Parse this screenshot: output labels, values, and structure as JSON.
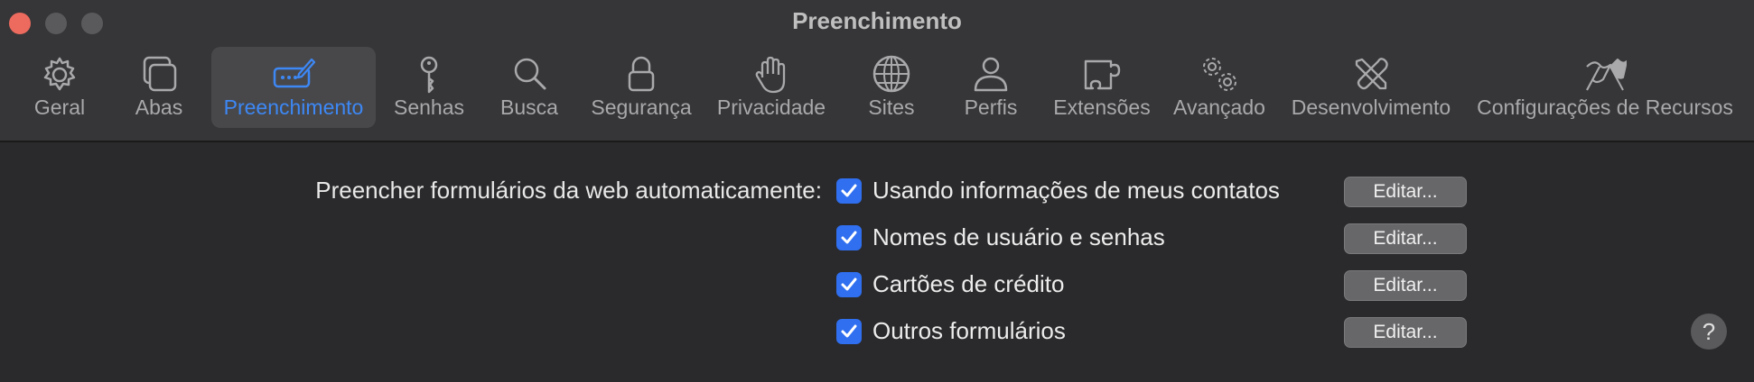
{
  "window": {
    "title": "Preenchimento"
  },
  "toolbar": {
    "tabs": [
      {
        "label": "Geral",
        "icon": "gear-icon"
      },
      {
        "label": "Abas",
        "icon": "tabs-icon"
      },
      {
        "label": "Preenchimento",
        "icon": "autofill-pen-icon",
        "active": true
      },
      {
        "label": "Senhas",
        "icon": "key-icon"
      },
      {
        "label": "Busca",
        "icon": "magnifier-icon"
      },
      {
        "label": "Segurança",
        "icon": "lock-icon"
      },
      {
        "label": "Privacidade",
        "icon": "hand-icon"
      },
      {
        "label": "Sites",
        "icon": "globe-icon"
      },
      {
        "label": "Perfis",
        "icon": "person-icon"
      },
      {
        "label": "Extensões",
        "icon": "puzzle-icon"
      },
      {
        "label": "Avançado",
        "icon": "gears-icon"
      },
      {
        "label": "Desenvolvimento",
        "icon": "tools-icon"
      },
      {
        "label": "Configurações de Recursos",
        "icon": "flags-icon"
      }
    ]
  },
  "autofill": {
    "section_label": "Preencher formulários da web automaticamente:",
    "options": [
      {
        "label": "Usando informações de meus contatos",
        "checked": true,
        "edit_label": "Editar..."
      },
      {
        "label": "Nomes de usuário e senhas",
        "checked": true,
        "edit_label": "Editar..."
      },
      {
        "label": "Cartões de crédito",
        "checked": true,
        "edit_label": "Editar..."
      },
      {
        "label": "Outros formulários",
        "checked": true,
        "edit_label": "Editar..."
      }
    ]
  },
  "help": {
    "label": "?"
  },
  "colors": {
    "accent": "#3d88f5",
    "checkbox": "#2f6ff0",
    "close": "#ed6a5e"
  }
}
